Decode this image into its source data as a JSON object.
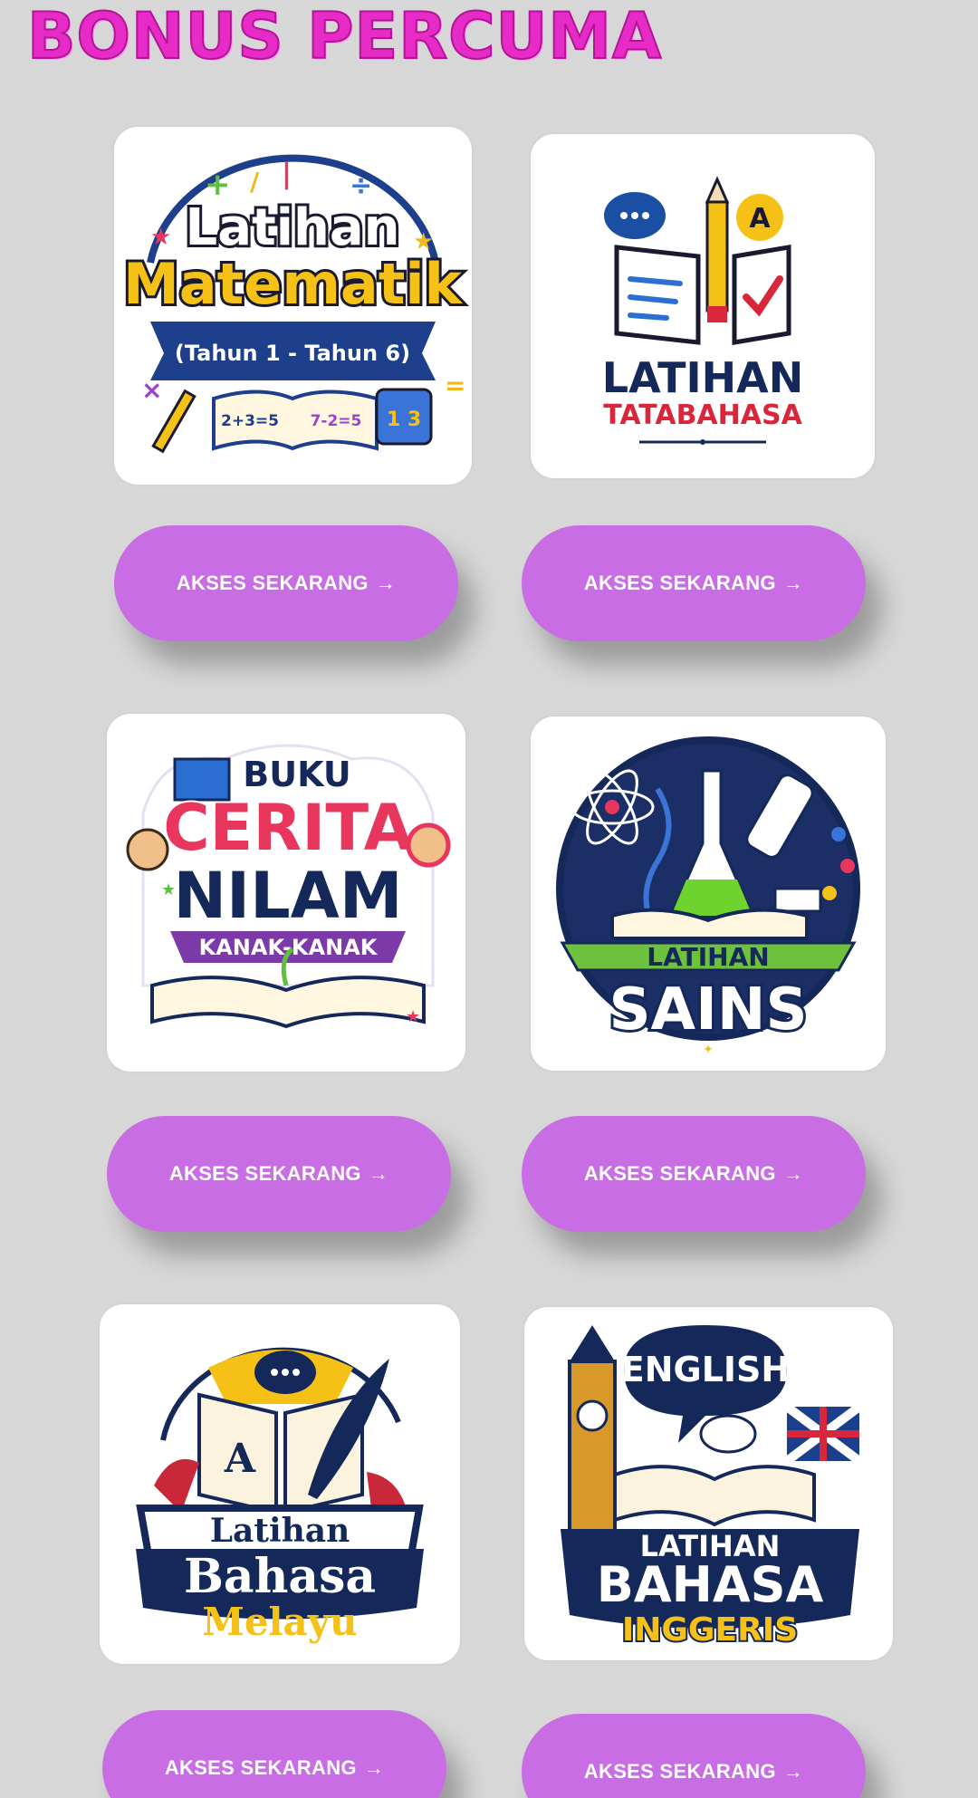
{
  "page": {
    "title": "BONUS PERCUMA"
  },
  "cards": [
    {
      "title_line1": "Latihan",
      "title_line2": "Matematik",
      "banner": "(Tahun 1 - Tahun 6)",
      "book_left": "2+3=5",
      "book_right": "7-2=5",
      "cube": "1 3",
      "button_label": "AKSES SEKARANG",
      "icon": "math-logo"
    },
    {
      "title_line1": "LATIHAN",
      "title_line2": "TATABAHASA",
      "badge": "A",
      "button_label": "AKSES SEKARANG",
      "icon": "grammar-logo"
    },
    {
      "title_line1": "BUKU",
      "title_line2": "CERITA",
      "title_line3": "NILAM",
      "banner": "KANAK-KANAK",
      "button_label": "AKSES SEKARANG",
      "icon": "story-book-logo"
    },
    {
      "title_line1": "LATIHAN",
      "title_line2": "SAINS",
      "button_label": "AKSES SEKARANG",
      "icon": "science-logo"
    },
    {
      "title_line1": "Latihan",
      "title_line2": "Bahasa",
      "title_line3": "Melayu",
      "book_letter": "A",
      "button_label": "AKSES SEKARANG",
      "icon": "malay-language-logo"
    },
    {
      "bubble": "ENGLISH",
      "title_line1": "LATIHAN",
      "title_line2": "BAHASA",
      "title_line3": "INGGERIS",
      "button_label": "AKSES SEKARANG",
      "icon": "english-language-logo"
    }
  ],
  "arrow_icon": "→",
  "colors": {
    "background": "#d7d7d7",
    "title": "#e62bc7",
    "button": "#c86de4",
    "button_text": "#ffffff"
  }
}
